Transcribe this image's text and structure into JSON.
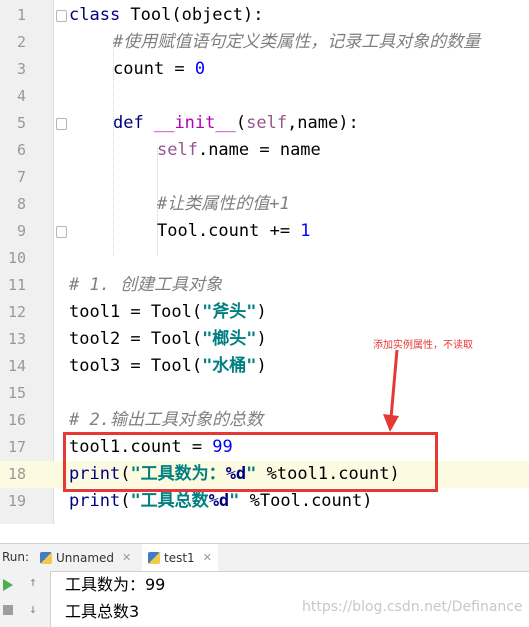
{
  "line_numbers": [
    "1",
    "2",
    "3",
    "4",
    "5",
    "6",
    "7",
    "8",
    "9",
    "10",
    "11",
    "12",
    "13",
    "14",
    "15",
    "16",
    "17",
    "18",
    "19"
  ],
  "code": {
    "l1_kw": "class",
    "l1_rest": " Tool(object):",
    "l2_cm": "#使用赋值语句定义类属性，记录工具对象的数量",
    "l3_a": "count = ",
    "l3_num": "0",
    "l5_kw": "def",
    "l5_sp": " ",
    "l5_fn": "__init__",
    "l5_p1": "(",
    "l5_self": "self",
    "l5_p2": ",name):",
    "l6_self": "self",
    "l6_rest": ".name = name",
    "l8_cm": "#让类属性的值+1",
    "l9_a": "Tool.count += ",
    "l9_num": "1",
    "l11_cm": "# 1. 创建工具对象",
    "l12_a": "tool1 = Tool(",
    "l12_str": "\"斧头\"",
    "l12_b": ")",
    "l13_a": "tool2 = Tool(",
    "l13_str": "\"榔头\"",
    "l13_b": ")",
    "l14_a": "tool3 = Tool(",
    "l14_str": "\"水桶\"",
    "l14_b": ")",
    "l16_cm": "# 2.输出工具对象的总数",
    "l17_a": "tool1.count = ",
    "l17_num": "99",
    "l18_fn": "print",
    "l18_p": "(",
    "l18_str1": "\"工具数为：",
    "l18_fmt": "%d",
    "l18_str2": "\"",
    "l18_rest": " %tool1.count)",
    "l19_fn": "print",
    "l19_p": "(",
    "l19_str1": "\"工具总数",
    "l19_fmt": "%d",
    "l19_str2": "\"",
    "l19_rest": " %Tool.count)"
  },
  "annotation": "添加实例属性，不读取",
  "run": {
    "label": "Run:",
    "tabs": [
      {
        "label": "Unnamed"
      },
      {
        "label": "test1"
      }
    ],
    "output": [
      "工具数为：99",
      "工具总数3"
    ]
  },
  "watermark": "https://blog.csdn.net/Definance",
  "colors": {
    "highlight_box": "#e53935",
    "keyword": "#000080",
    "number": "#0000ff",
    "comment": "#808080",
    "string": "#008080"
  }
}
